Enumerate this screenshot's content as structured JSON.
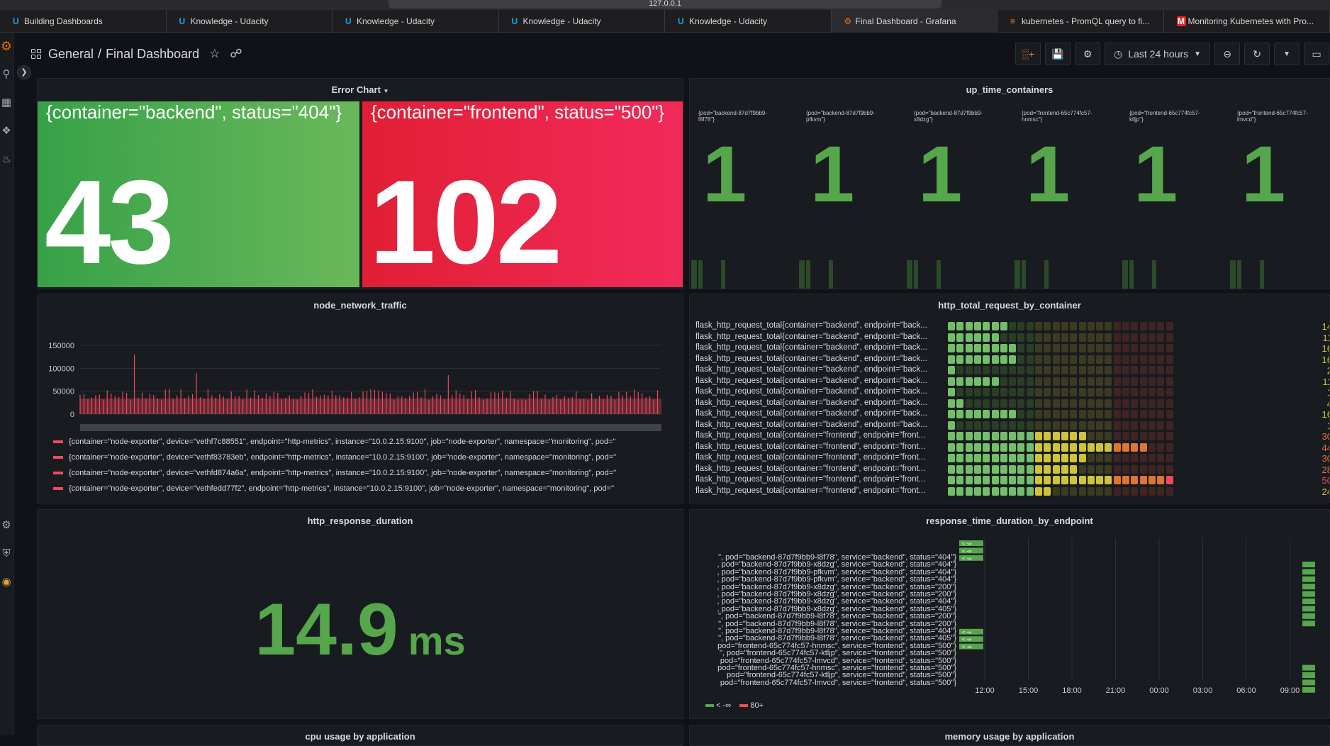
{
  "browser": {
    "url": "127.0.0.1",
    "tabs": [
      {
        "label": "Building Dashboards",
        "icon": "udacity-icon",
        "active": false
      },
      {
        "label": "Knowledge - Udacity",
        "icon": "udacity-icon",
        "active": false
      },
      {
        "label": "Knowledge - Udacity",
        "icon": "udacity-icon",
        "active": false
      },
      {
        "label": "Knowledge - Udacity",
        "icon": "udacity-icon",
        "active": false
      },
      {
        "label": "Knowledge - Udacity",
        "icon": "udacity-icon",
        "active": false
      },
      {
        "label": "Final Dashboard - Grafana",
        "icon": "grafana-icon",
        "active": true
      },
      {
        "label": "kubernetes - PromQL query to fi...",
        "icon": "stackoverflow-icon",
        "active": false
      },
      {
        "label": "Monitoring Kubernetes with Pro...",
        "icon": "medium-icon",
        "active": false
      }
    ]
  },
  "header": {
    "folder": "General",
    "separator": "/",
    "dashboard": "Final Dashboard",
    "time_range": "Last 24 hours"
  },
  "panels": {
    "error_chart": {
      "title": "Error Chart",
      "stats": [
        {
          "label": "{container=\"backend\", status=\"404\"}",
          "value": "43",
          "color": "#37a148"
        },
        {
          "label": "{container=\"frontend\", status=\"500\"}",
          "value": "102",
          "color": "#e01f35"
        }
      ]
    },
    "up_time": {
      "title": "up_time_containers",
      "items": [
        {
          "label": "{pod=\"backend-87d7f9bb9-l8f78\"}",
          "value": "1"
        },
        {
          "label": "{pod=\"backend-87d7f9bb9-pfkvm\"}",
          "value": "1"
        },
        {
          "label": "{pod=\"backend-87d7f9bb9-x8dzg\"}",
          "value": "1"
        },
        {
          "label": "{pod=\"frontend-65c774fc57-hnmsc\"}",
          "value": "1"
        },
        {
          "label": "{pod=\"frontend-65c774fc57-ktljp\"}",
          "value": "1"
        },
        {
          "label": "{pod=\"frontend-65c774fc57-lmvcd\"}",
          "value": "1"
        }
      ]
    },
    "network": {
      "title": "node_network_traffic",
      "legend": [
        "{container=\"node-exporter\", device=\"vethf7c88551\", endpoint=\"http-metrics\", instance=\"10.0.2.15:9100\", job=\"node-exporter\", namespace=\"monitoring\", pod=\"",
        "{container=\"node-exporter\", device=\"vethf83783eb\", endpoint=\"http-metrics\", instance=\"10.0.2.15:9100\", job=\"node-exporter\", namespace=\"monitoring\", pod=\"",
        "{container=\"node-exporter\", device=\"vethfd874a6a\", endpoint=\"http-metrics\", instance=\"10.0.2.15:9100\", job=\"node-exporter\", namespace=\"monitoring\", pod=\"",
        "{container=\"node-exporter\", device=\"vethfedd77f2\", endpoint=\"http-metrics\", instance=\"10.0.2.15:9100\", job=\"node-exporter\", namespace=\"monitoring\", pod=\""
      ]
    },
    "requests": {
      "title": "http_total_request_by_container",
      "rows": [
        {
          "label": "flask_http_request_total{container=\"backend\", endpoint=\"back...",
          "value": 14
        },
        {
          "label": "flask_http_request_total{container=\"backend\", endpoint=\"back...",
          "value": 11
        },
        {
          "label": "flask_http_request_total{container=\"backend\", endpoint=\"back...",
          "value": 16
        },
        {
          "label": "flask_http_request_total{container=\"backend\", endpoint=\"back...",
          "value": 16
        },
        {
          "label": "flask_http_request_total{container=\"backend\", endpoint=\"back...",
          "value": 2
        },
        {
          "label": "flask_http_request_total{container=\"backend\", endpoint=\"back...",
          "value": 11
        },
        {
          "label": "flask_http_request_total{container=\"backend\", endpoint=\"back...",
          "value": 1
        },
        {
          "label": "flask_http_request_total{container=\"backend\", endpoint=\"back...",
          "value": 4
        },
        {
          "label": "flask_http_request_total{container=\"backend\", endpoint=\"back...",
          "value": 16
        },
        {
          "label": "flask_http_request_total{container=\"backend\", endpoint=\"back...",
          "value": 1
        },
        {
          "label": "flask_http_request_total{container=\"frontend\", endpoint=\"front...",
          "value": 30
        },
        {
          "label": "flask_http_request_total{container=\"frontend\", endpoint=\"front...",
          "value": 44
        },
        {
          "label": "flask_http_request_total{container=\"frontend\", endpoint=\"front...",
          "value": 30
        },
        {
          "label": "flask_http_request_total{container=\"frontend\", endpoint=\"front...",
          "value": 28
        },
        {
          "label": "flask_http_request_total{container=\"frontend\", endpoint=\"front...",
          "value": 50
        },
        {
          "label": "flask_http_request_total{container=\"frontend\", endpoint=\"front...",
          "value": 24
        }
      ],
      "max": 50
    },
    "duration": {
      "title": "http_response_duration",
      "value": "14.9",
      "unit": "ms"
    },
    "heatmap": {
      "title": "response_time_duration_by_endpoint",
      "rows": [
        "\", pod=\"backend-87d7f9bb9-l8f78\", service=\"backend\", status=\"404\"}",
        ", pod=\"backend-87d7f9bb9-x8dzg\", service=\"backend\", status=\"404\"}",
        ", pod=\"backend-87d7f9bb9-pfkvm\", service=\"backend\", status=\"404\"}",
        ", pod=\"backend-87d7f9bb9-pfkvm\", service=\"backend\", status=\"404\"}",
        ", pod=\"backend-87d7f9bb9-x8dzg\", service=\"backend\", status=\"200\"}",
        ", pod=\"backend-87d7f9bb9-x8dzg\", service=\"backend\", status=\"200\"}",
        ", pod=\"backend-87d7f9bb9-x8dzg\", service=\"backend\", status=\"404\"}",
        ", pod=\"backend-87d7f9bb9-x8dzg\", service=\"backend\", status=\"405\"}",
        "\", pod=\"backend-87d7f9bb9-l8f78\", service=\"backend\", status=\"200\"}",
        "\", pod=\"backend-87d7f9bb9-l8f78\", service=\"backend\", status=\"200\"}",
        "\", pod=\"backend-87d7f9bb9-l8f78\", service=\"backend\", status=\"404\"}",
        "\", pod=\"backend-87d7f9bb9-l8f78\", service=\"backend\", status=\"405\"}",
        "pod=\"frontend-65c774fc57-hnmsc\", service=\"frontend\", status=\"500\"}",
        "\", pod=\"frontend-65c774fc57-ktljp\", service=\"frontend\", status=\"500\"}",
        "pod=\"frontend-65c774fc57-lmvcd\", service=\"frontend\", status=\"500\"}",
        "pod=\"frontend-65c774fc57-hnmsc\", service=\"frontend\", status=\"500\"}",
        "pod=\"frontend-65c774fc57-ktljp\", service=\"frontend\", status=\"500\"}",
        "pod=\"frontend-65c774fc57-lmvcd\", service=\"frontend\", status=\"500\"}"
      ],
      "cell_label": "< -∞",
      "x_ticks": [
        "12:00",
        "15:00",
        "18:00",
        "21:00",
        "00:00",
        "03:00",
        "06:00",
        "09:00"
      ],
      "legend": [
        "< -∞",
        "80+"
      ]
    },
    "bottom": {
      "left_title": "cpu usage by application",
      "right_title": "memory usage by application"
    }
  },
  "chart_data": {
    "type": "bar",
    "title": "node_network_traffic",
    "ylim": [
      0,
      150000
    ],
    "y_ticks": [
      0,
      50000,
      100000,
      150000
    ],
    "peaks": [
      130000,
      90000,
      85000
    ],
    "typical_range": [
      30000,
      55000
    ]
  }
}
